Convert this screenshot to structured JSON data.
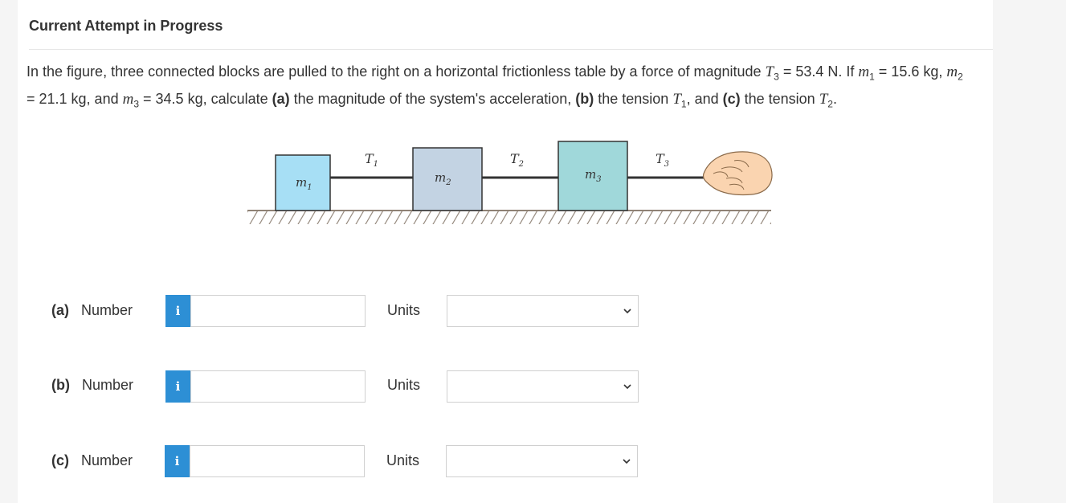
{
  "header": {
    "title": "Current Attempt in Progress"
  },
  "question": {
    "p1": "In the figure, three connected blocks are pulled to the right on a horizontal frictionless table by a force of magnitude ",
    "T3_sym": "T",
    "T3_sub": "3",
    "p2": " = 53.4 N. If ",
    "m1_sym": "m",
    "m1_sub": "1",
    "p3": " = 15.6 kg, ",
    "m2_sym": "m",
    "m2_sub": "2",
    "p4": " = 21.1 kg, and ",
    "m3_sym": "m",
    "m3_sub": "3",
    "p5": " = 34.5 kg, calculate ",
    "a_tag": "(a)",
    "p6": " the magnitude of the system's acceleration, ",
    "b_tag": "(b)",
    "p7": " the tension ",
    "T1_sym": "T",
    "T1_sub": "1",
    "p8": ", and ",
    "c_tag": "(c)",
    "p9": " the tension ",
    "T2_sym": "T",
    "T2_sub": "2",
    "p10": "."
  },
  "figure": {
    "m1": "m",
    "m1_sub": "1",
    "m2": "m",
    "m2_sub": "2",
    "m3": "m",
    "m3_sub": "3",
    "T1": "T",
    "T1_sub": "1",
    "T2": "T",
    "T2_sub": "2",
    "T3": "T",
    "T3_sub": "3",
    "colors": {
      "m1": "#a7dff5",
      "m2": "#c3d3e3",
      "m3": "#a0d8da",
      "table": "#8f8275",
      "hand": "#fad4b0"
    }
  },
  "answers": [
    {
      "tag": "(a)",
      "label": "Number",
      "info": "i",
      "value": "",
      "units_label": "Units",
      "units_value": ""
    },
    {
      "tag": "(b)",
      "label": "Number",
      "info": "i",
      "value": "",
      "units_label": "Units",
      "units_value": ""
    },
    {
      "tag": "(c)",
      "label": "Number",
      "info": "i",
      "value": "",
      "units_label": "Units",
      "units_value": ""
    }
  ]
}
